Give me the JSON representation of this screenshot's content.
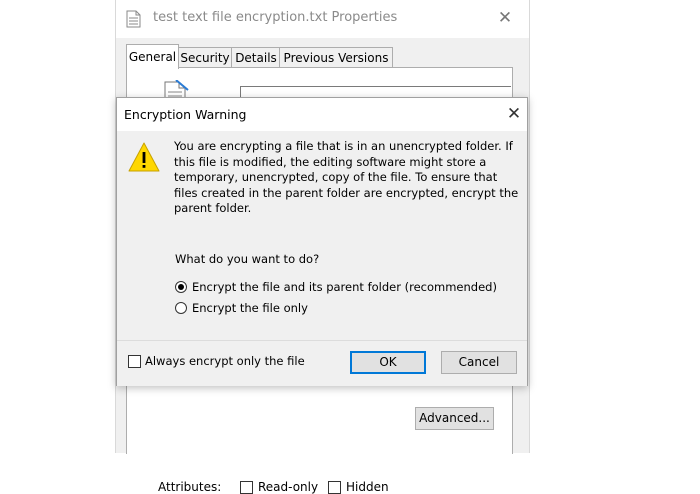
{
  "properties_window": {
    "title": "test text file encryption.txt Properties",
    "tabs": [
      {
        "label": "General",
        "active": true
      },
      {
        "label": "Security",
        "active": false
      },
      {
        "label": "Details",
        "active": false
      },
      {
        "label": "Previous Versions",
        "active": false
      }
    ],
    "attributes_label": "Attributes:",
    "read_only_label": "Read-only",
    "hidden_label": "Hidden",
    "advanced_button": "Advanced..."
  },
  "dialog": {
    "title": "Encryption Warning",
    "icon": "warning-icon",
    "message": "You are encrypting a file that is in an unencrypted folder. If this file is modified, the editing software might store a temporary, unencrypted, copy of the file. To ensure that files created in the parent folder are encrypted, encrypt the parent folder.",
    "question": "What do you want to do?",
    "options": [
      {
        "label": "Encrypt the file and its parent folder (recommended)",
        "selected": true
      },
      {
        "label": "Encrypt the file only",
        "selected": false
      }
    ],
    "always_checkbox_label": "Always encrypt only the file",
    "always_checkbox_checked": false,
    "ok_label": "OK",
    "cancel_label": "Cancel"
  },
  "colors": {
    "accent": "#0078d7",
    "warning_icon": "#ffd700"
  }
}
